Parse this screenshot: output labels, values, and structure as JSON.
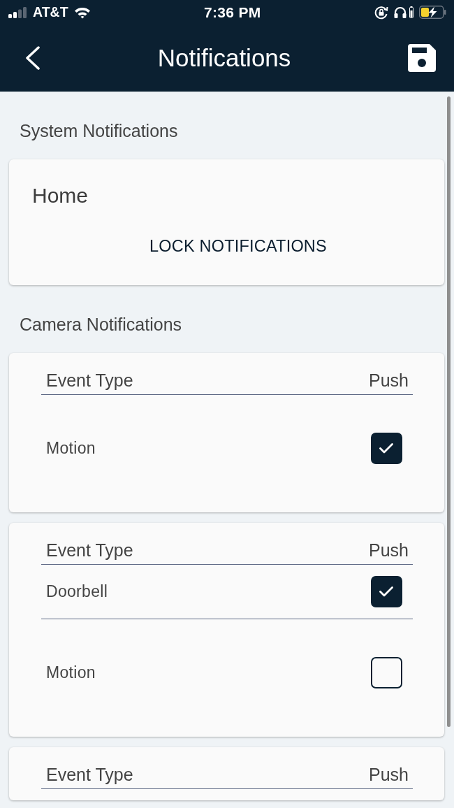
{
  "status_bar": {
    "carrier": "AT&T",
    "time": "7:36 PM"
  },
  "header": {
    "title": "Notifications"
  },
  "sections": [
    {
      "title": "System Notifications",
      "cards": [
        {
          "kind": "system",
          "title": "Home",
          "action": "LOCK NOTIFICATIONS"
        }
      ]
    },
    {
      "title": "Camera Notifications",
      "cards": [
        {
          "kind": "events",
          "columns": [
            "Event Type",
            "Push"
          ],
          "rows": [
            {
              "event": "Motion",
              "checked": true
            }
          ]
        },
        {
          "kind": "events",
          "columns": [
            "Event Type",
            "Push"
          ],
          "rows": [
            {
              "event": "Doorbell",
              "checked": true
            },
            {
              "event": "Motion",
              "checked": false
            }
          ]
        },
        {
          "kind": "events",
          "columns": [
            "Event Type",
            "Push"
          ]
        }
      ]
    }
  ]
}
